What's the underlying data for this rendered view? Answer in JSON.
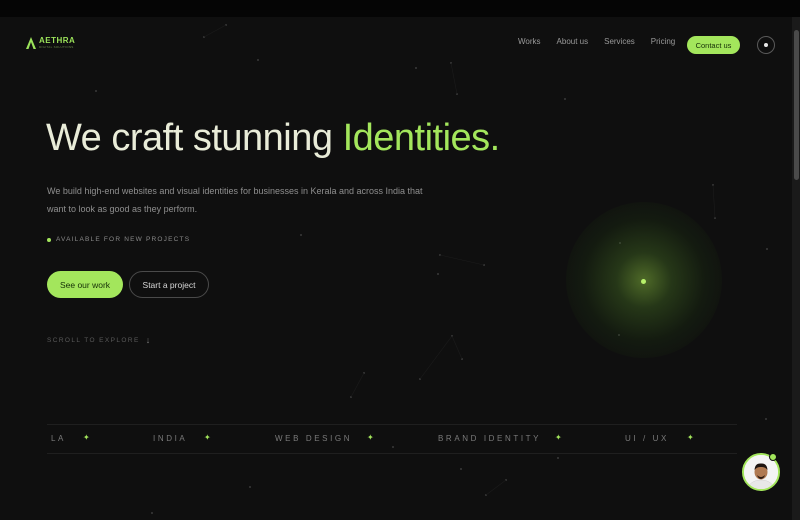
{
  "brand": {
    "name": "AETHRA",
    "tagline": "DIGITAL SOLUTIONS",
    "accent_color": "#a3e65c"
  },
  "nav": {
    "links": [
      "Works",
      "About us",
      "Services",
      "Pricing"
    ],
    "contact_label": "Contact us",
    "theme_toggle_icon": "sun-icon"
  },
  "hero": {
    "title_main": "We craft stunning ",
    "title_accent": "Identities.",
    "description": "We build high-end websites and visual identities for businesses in Kerala and across India that want to look as good as they perform.",
    "availability": "AVAILABLE FOR NEW PROJECTS",
    "primary_button": "See our work",
    "secondary_button": "Start a project",
    "scroll_hint": "SCROLL TO EXPLORE"
  },
  "marquee": {
    "items": [
      "LA",
      "INDIA",
      "WEB DESIGN",
      "BRAND IDENTITY",
      "UI / UX"
    ],
    "separator_icon": "sparkle-icon"
  },
  "chat": {
    "avatar_icon": "profile-avatar",
    "status_color": "#a3e65c"
  }
}
